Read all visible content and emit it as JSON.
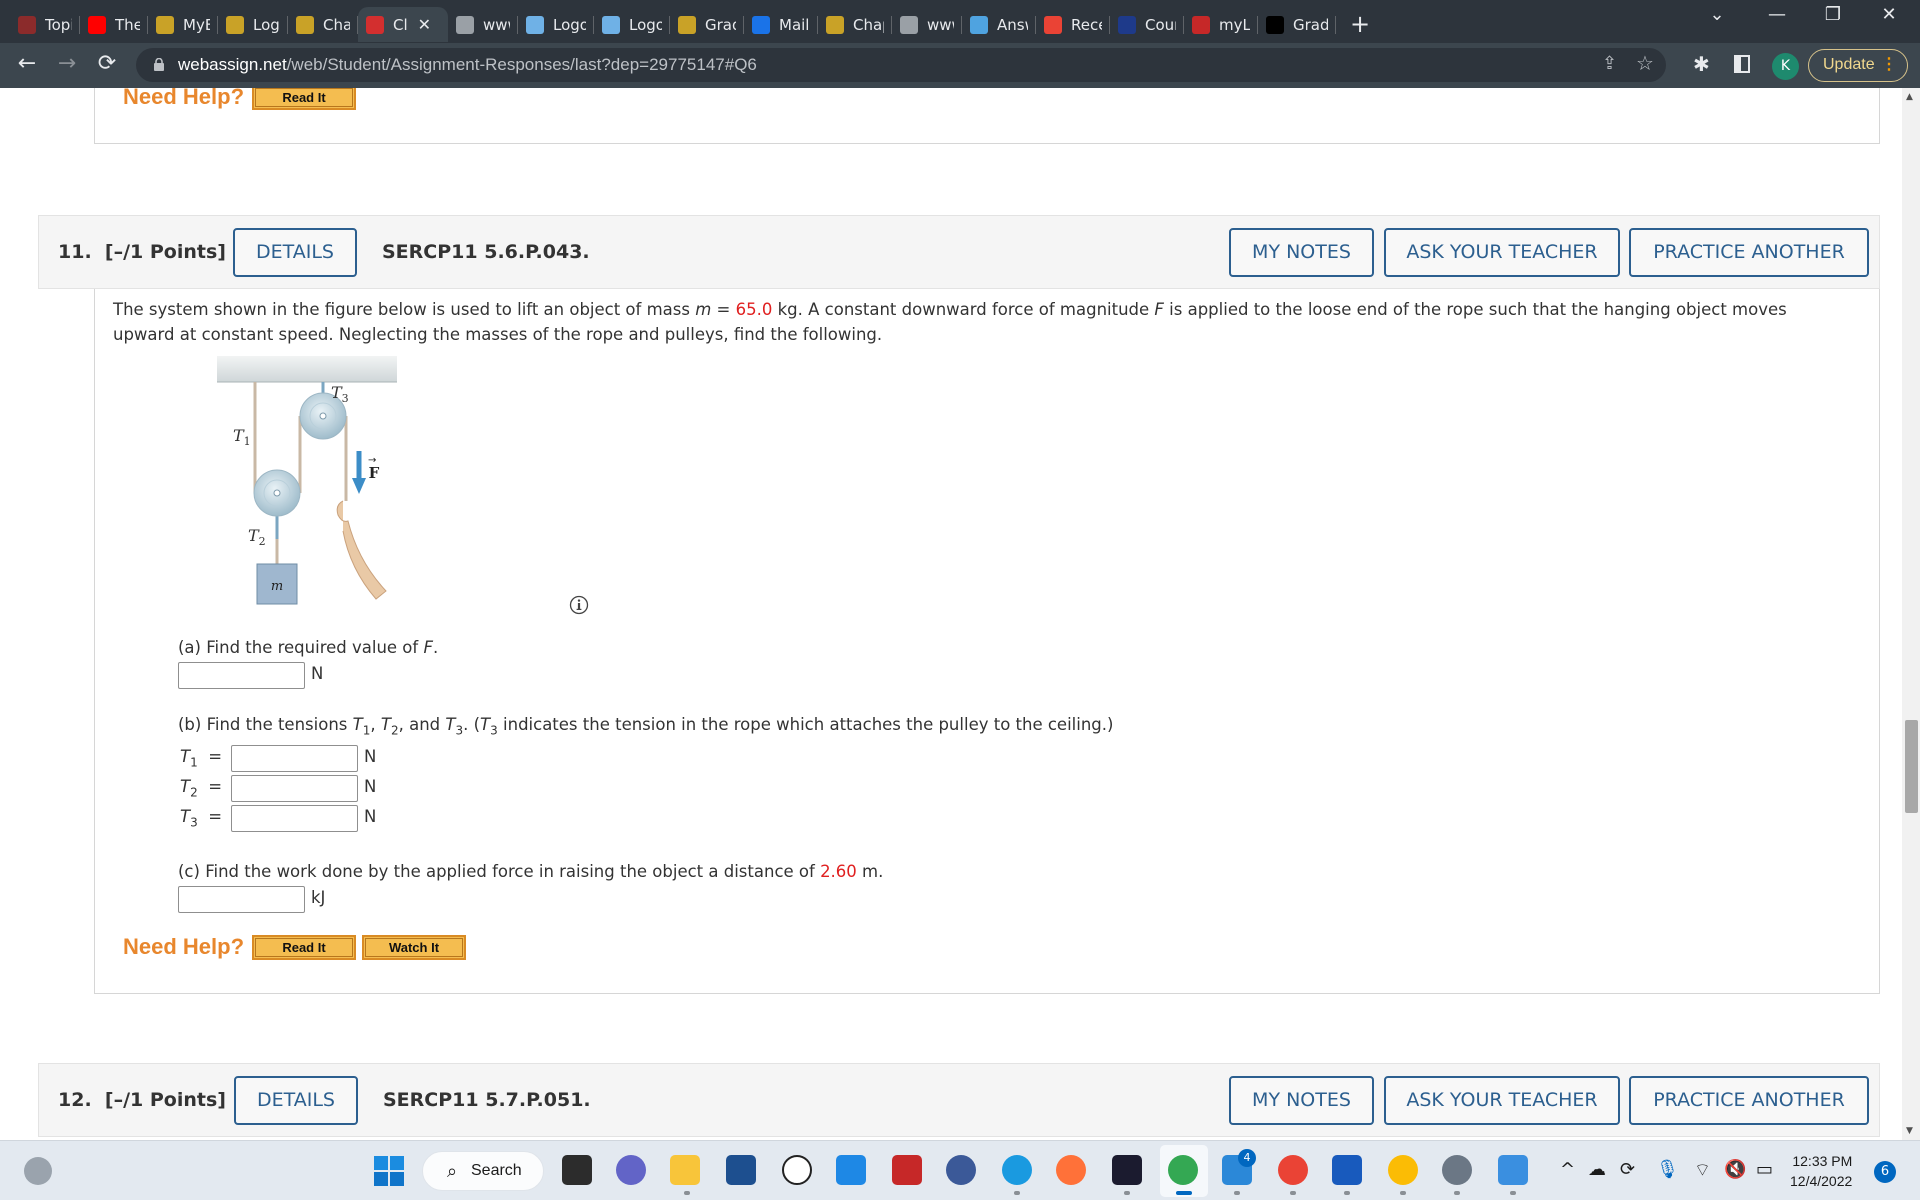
{
  "browser": {
    "tabs": [
      {
        "title": "Topic",
        "icon": "hcc-shield-icon",
        "color": "#8b2b2b"
      },
      {
        "title": "The sl",
        "icon": "youtube-icon",
        "color": "#ff0000"
      },
      {
        "title": "MyEa",
        "icon": "hcc-icon",
        "color": "#c9a227"
      },
      {
        "title": "Log Ir",
        "icon": "hcc-icon",
        "color": "#c9a227"
      },
      {
        "title": "Chapt",
        "icon": "hcc-icon",
        "color": "#c9a227"
      },
      {
        "title": "Cl",
        "icon": "cengage-icon",
        "color": "#d32f2f",
        "active": true
      },
      {
        "title": "www.",
        "icon": "globe-icon",
        "color": "#9aa0a6"
      },
      {
        "title": "Logou",
        "icon": "logout-icon",
        "color": "#6fb1e6"
      },
      {
        "title": "Logou",
        "icon": "logout-icon",
        "color": "#6fb1e6"
      },
      {
        "title": "Grade",
        "icon": "hcc-icon",
        "color": "#c9a227"
      },
      {
        "title": "Mail -",
        "icon": "outlook-icon",
        "color": "#1a73e8"
      },
      {
        "title": "Chapt",
        "icon": "hcc-icon",
        "color": "#c9a227"
      },
      {
        "title": "www.",
        "icon": "globe-icon",
        "color": "#9aa0a6"
      },
      {
        "title": "Answ",
        "icon": "answers-icon",
        "color": "#4fa3e0"
      },
      {
        "title": "Recen",
        "icon": "gmail-icon",
        "color": "#ea4335"
      },
      {
        "title": "Cours",
        "icon": "star-badge-icon",
        "color": "#1e3a8a"
      },
      {
        "title": "myLo",
        "icon": "texas-icon",
        "color": "#c62828"
      },
      {
        "title": "Grade",
        "icon": "d2l-icon",
        "color": "#000000"
      }
    ],
    "new_tab": "+",
    "url_host": "webassign.net",
    "url_path": "/web/Student/Assignment-Responses/last?dep=29775147#Q6",
    "profile_initial": "K",
    "update_label": "Update"
  },
  "prev_question": {
    "need_help": "Need Help?",
    "read_it": "Read It"
  },
  "question11": {
    "number": "11.",
    "points": "[–/1 Points]",
    "details": "DETAILS",
    "code": "SERCP11 5.6.P.043.",
    "my_notes": "MY NOTES",
    "ask_teacher": "ASK YOUR TEACHER",
    "practice_another": "PRACTICE ANOTHER",
    "prompt_1": "The system shown in the figure below is used to lift an object of mass ",
    "prompt_m": "m",
    "prompt_eq": " = ",
    "mass_value": "65.0",
    "prompt_2": " kg. A constant downward force of magnitude ",
    "prompt_F": "F",
    "prompt_3": " is applied to the loose end of the rope such that the hanging object moves upward at constant speed. Neglecting the masses of the rope and pulleys, find the following.",
    "figure": {
      "labels": {
        "t1": "T",
        "t1_sub": "1",
        "t2": "T",
        "t2_sub": "2",
        "t3": "T",
        "t3_sub": "3",
        "force": "F",
        "mass": "m"
      }
    },
    "part_a": {
      "text": "(a) Find the required value of ",
      "var": "F",
      "end": ".",
      "unit": "N",
      "value": ""
    },
    "part_b": {
      "text_1": "(b) Find the tensions ",
      "text_2": ", and ",
      "text_3": ". (",
      "text_4": " indicates the tension in the rope which attaches the pulley to the ceiling.)",
      "rows": [
        {
          "var": "T",
          "sub": "1",
          "eq": "=",
          "unit": "N",
          "value": ""
        },
        {
          "var": "T",
          "sub": "2",
          "eq": "=",
          "unit": "N",
          "value": ""
        },
        {
          "var": "T",
          "sub": "3",
          "eq": "=",
          "unit": "N",
          "value": ""
        }
      ]
    },
    "part_c": {
      "text": "(c) Find the work done by the applied force in raising the object a distance of ",
      "distance": "2.60",
      "end": " m.",
      "unit": "kJ",
      "value": ""
    },
    "need_help": "Need Help?",
    "read_it": "Read It",
    "watch_it": "Watch It"
  },
  "question12": {
    "number": "12.",
    "points": "[–/1 Points]",
    "details": "DETAILS",
    "code": "SERCP11 5.7.P.051.",
    "my_notes": "MY NOTES",
    "ask_teacher": "ASK YOUR TEACHER",
    "practice_another": "PRACTICE ANOTHER"
  },
  "taskbar": {
    "search_label": "Search",
    "time": "12:33 PM",
    "date": "12/4/2022",
    "notifications": "6",
    "mail_badge": "4"
  }
}
